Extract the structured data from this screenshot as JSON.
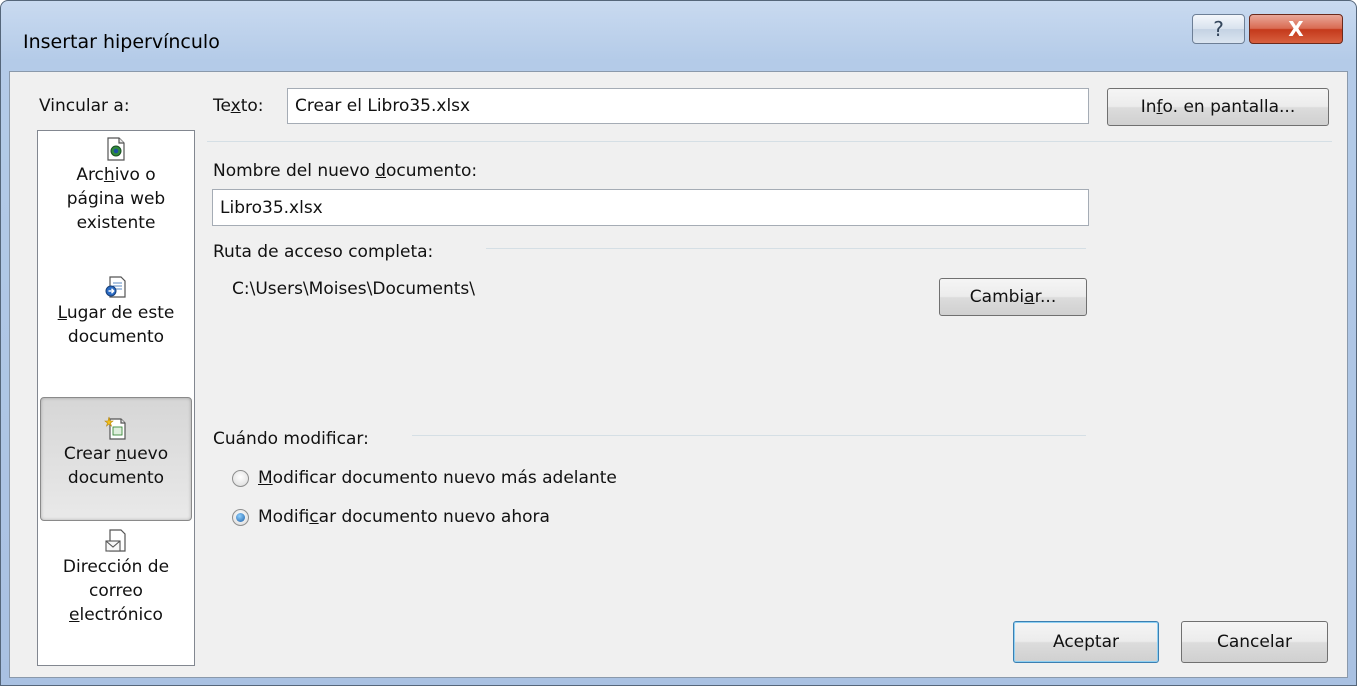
{
  "window": {
    "title": "Insertar hipervínculo",
    "help_label": "?",
    "close_label": "X"
  },
  "link_to": {
    "heading": "Vincular a:",
    "items": [
      {
        "line1_pre": "Arc",
        "line1_u": "h",
        "line1_post": "ivo o",
        "line2": "página web",
        "line3": "existente",
        "icon": "file-web-icon"
      },
      {
        "line1_pre": "",
        "line1_u": "L",
        "line1_post": "ugar de este",
        "line2": "documento",
        "line3": "",
        "icon": "document-place-icon"
      },
      {
        "line1_pre": "Crear ",
        "line1_u": "n",
        "line1_post": "uevo",
        "line2": "documento",
        "line3": "",
        "icon": "new-document-icon"
      },
      {
        "line1_pre": "Dirección de",
        "line1_u": "",
        "line1_post": "",
        "line2": "correo",
        "line3_pre": "",
        "line3_u": "e",
        "line3_post": "lectrónico",
        "icon": "email-icon"
      }
    ]
  },
  "text_field": {
    "label_pre": "Te",
    "label_u": "x",
    "label_post": "to:",
    "value": "Crear el Libro35.xlsx"
  },
  "screentip_button": {
    "pre": "In",
    "u": "f",
    "post": "o. en pantalla..."
  },
  "new_document": {
    "label_pre": "Nombre del nuevo ",
    "label_u": "d",
    "label_post": "ocumento:",
    "value": "Libro35.xlsx"
  },
  "full_path": {
    "label": "Ruta de acceso completa:",
    "value": "C:\\Users\\Moises\\Documents\\"
  },
  "change_button": {
    "pre": "Cambi",
    "u": "a",
    "post": "r..."
  },
  "when_edit": {
    "label": "Cuándo modificar:",
    "options": [
      {
        "pre": "",
        "u": "M",
        "post": "odificar documento nuevo más adelante",
        "checked": false
      },
      {
        "pre": "Modifi",
        "u": "c",
        "post": "ar documento nuevo ahora",
        "checked": true
      }
    ]
  },
  "ok_label": "Aceptar",
  "cancel_label": "Cancelar"
}
